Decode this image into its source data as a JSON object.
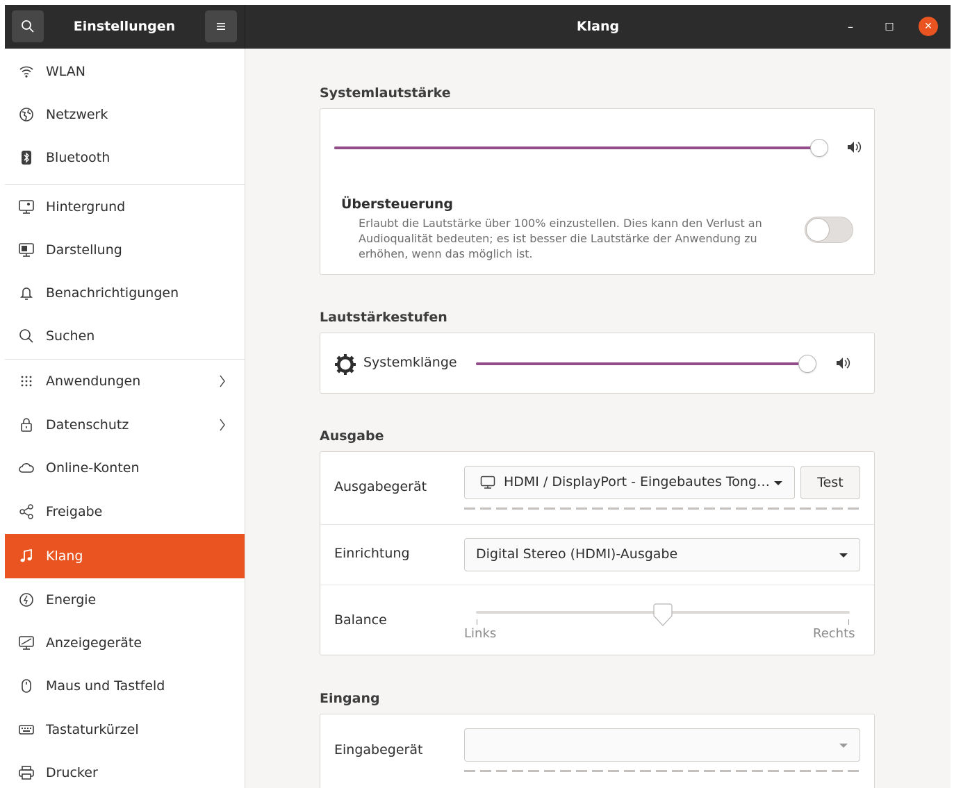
{
  "headerbar": {
    "search_icon": "search-icon",
    "left_title": "Einstellungen",
    "menu_icon": "hamburger-menu-icon",
    "title": "Klang",
    "window_controls": {
      "minimize": "–",
      "maximize": "□",
      "close": "✕"
    }
  },
  "sidebar": {
    "items": [
      {
        "label": "WLAN",
        "icon": "wifi-icon"
      },
      {
        "label": "Netzwerk",
        "icon": "network-icon"
      },
      {
        "label": "Bluetooth",
        "icon": "bluetooth-icon"
      },
      {
        "label": "Hintergrund",
        "icon": "background-icon"
      },
      {
        "label": "Darstellung",
        "icon": "appearance-icon"
      },
      {
        "label": "Benachrichtigungen",
        "icon": "bell-icon"
      },
      {
        "label": "Suchen",
        "icon": "search-icon"
      },
      {
        "label": "Anwendungen",
        "icon": "apps-grid-icon",
        "has_submenu": true
      },
      {
        "label": "Datenschutz",
        "icon": "lock-icon",
        "has_submenu": true
      },
      {
        "label": "Online-Konten",
        "icon": "cloud-icon"
      },
      {
        "label": "Freigabe",
        "icon": "share-icon"
      },
      {
        "label": "Klang",
        "icon": "music-note-icon",
        "active": true
      },
      {
        "label": "Energie",
        "icon": "power-icon"
      },
      {
        "label": "Anzeigegeräte",
        "icon": "display-icon"
      },
      {
        "label": "Maus und Tastfeld",
        "icon": "mouse-icon"
      },
      {
        "label": "Tastaturkürzel",
        "icon": "keyboard-icon"
      },
      {
        "label": "Drucker",
        "icon": "printer-icon"
      }
    ],
    "active_color": "#e95420"
  },
  "system_volume": {
    "title": "Systemlautstärke",
    "level": 1.0,
    "speaker_icon": "speaker-icon",
    "overamplification": {
      "title": "Übersteuerung",
      "description_lines": [
        "Erlaubt die Lautstärke über 100% einzustellen. Dies kann den Verlust an",
        "Audioqualität bedeuten; es ist besser die Lautstärke der Anwendung zu",
        "erhöhen, wenn das möglich ist."
      ],
      "enabled": false
    }
  },
  "volume_levels": {
    "title": "Lautstärkestufen",
    "system_sounds_label": "Systemklänge",
    "system_sounds_icon": "gear-icon",
    "level": 1.0
  },
  "output": {
    "title": "Ausgabe",
    "device_label": "Ausgabegerät",
    "device_value": "HDMI / DisplayPort - Eingebautes Tong…",
    "device_icon": "monitor-icon",
    "test_button": "Test",
    "config_label": "Einrichtung",
    "config_value": "Digital Stereo (HDMI)-Ausgabe",
    "balance_label": "Balance",
    "balance_left": "Links",
    "balance_right": "Rechts",
    "balance_position": 0.5
  },
  "input": {
    "title": "Eingang",
    "device_label": "Eingabegerät",
    "device_value": ""
  },
  "colors": {
    "accent": "#e95420",
    "slider_fill": "#924d8b",
    "header": "#2c2c2c"
  }
}
